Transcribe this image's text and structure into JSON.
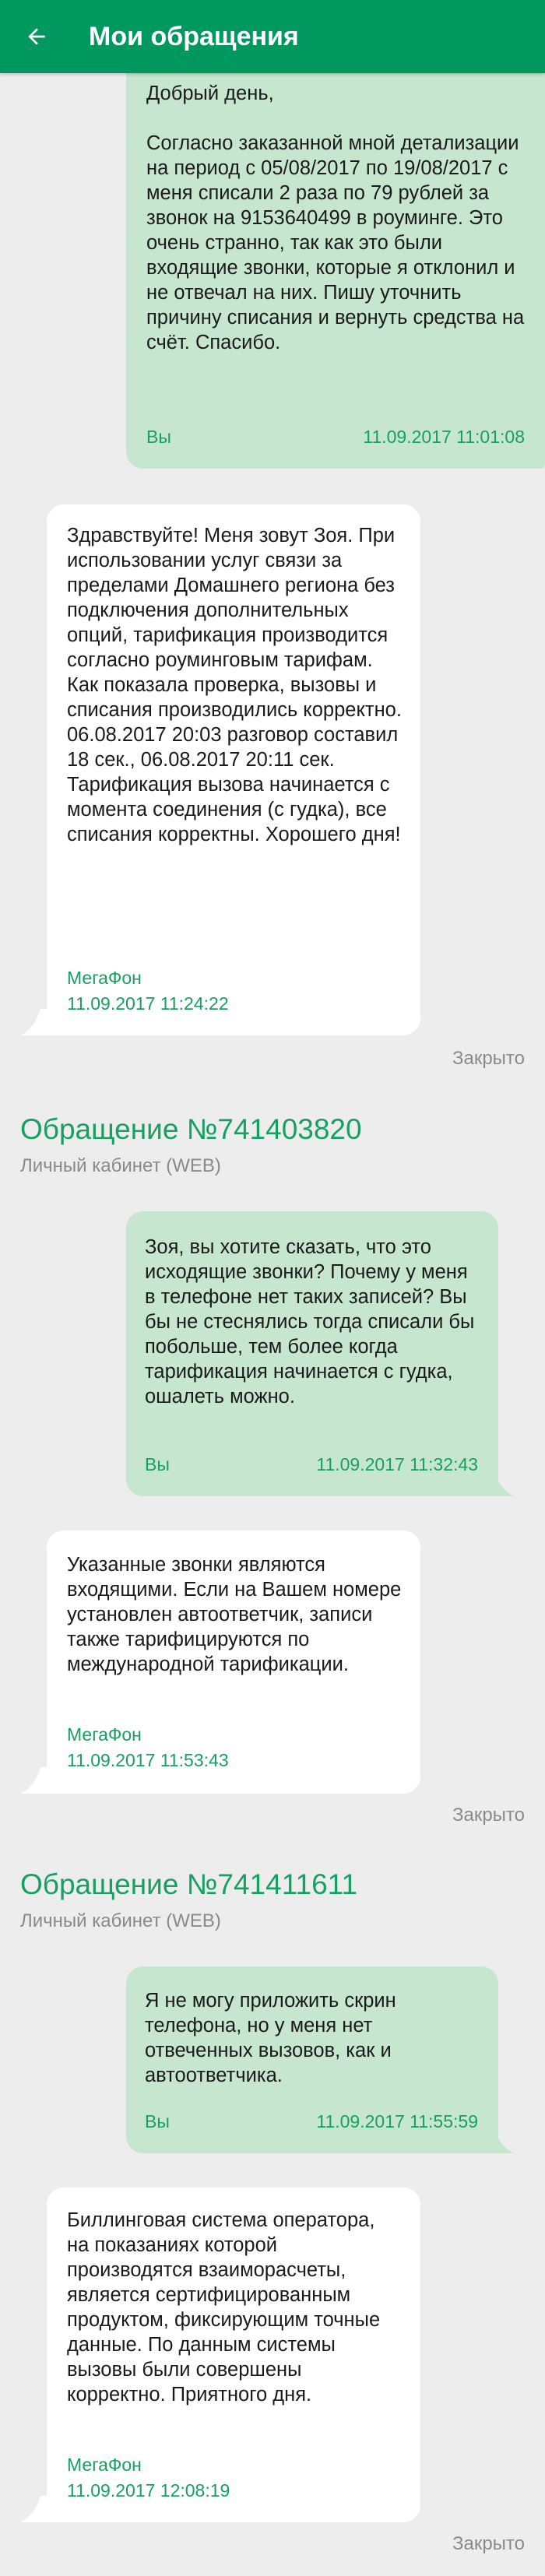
{
  "header": {
    "title": "Мои обращения",
    "back_icon": "arrow-left-icon"
  },
  "colors": {
    "primary": "#00985f",
    "accent_text": "#17a062",
    "my_bubble": "#c7e6cf",
    "reply_bubble": "#ffffff",
    "background": "#ededed"
  },
  "thread1": {
    "user_message": {
      "text": "Добрый день,\n\nСогласно заказанной мной детализации на период с 05/08/2017 по 19/08/2017 с меня списали 2 раза по 79 рублей за звонок на 9153640499 в роуминге. Это очень странно, так как это были входящие звонки, которые я отклонил и не отвечал на них. Пишу уточнить причину списания и вернуть средства на счёт. Спасибо.",
      "author": "Вы",
      "time": "11.09.2017 11:01:08"
    },
    "reply": {
      "text": "Здравствуйте! Меня зовут Зоя. При использовании услуг связи за пределами Домашнего региона без подключения дополнительных опций, тарификация производится согласно роуминговым тарифам. Как показала проверка, вызовы и списания производились корректно. 06.08.2017 20:03 разговор составил 18 сек., 06.08.2017 20:11 сек. Тарификация вызова начинается с момента соединения (с гудка), все списания корректны. Хорошего дня!",
      "author": "МегаФон",
      "time": "11.09.2017 11:24:22"
    },
    "status": "Закрыто"
  },
  "thread2": {
    "title": "Обращение №741403820",
    "channel": "Личный кабинет (WEB)",
    "user_message": {
      "text": "Зоя, вы хотите сказать, что это исходящие звонки? Почему у меня в телефоне нет таких записей? Вы бы не стеснялись тогда списали бы побольше, тем более когда тарификация начинается с гудка, ошалеть можно.",
      "author": "Вы",
      "time": "11.09.2017 11:32:43"
    },
    "reply": {
      "text": "Указанные звонки являются входящими. Если на Вашем номере установлен автоответчик, записи также тарифицируются по международной тарификации.",
      "author": "МегаФон",
      "time": "11.09.2017 11:53:43"
    },
    "status": "Закрыто"
  },
  "thread3": {
    "title": "Обращение №741411611",
    "channel": "Личный кабинет (WEB)",
    "user_message": {
      "text": "Я не могу приложить скрин телефона, но у меня нет отвеченных вызовов, как и автоответчика.",
      "author": "Вы",
      "time": "11.09.2017 11:55:59"
    },
    "reply": {
      "text": "Биллинговая система оператора, на показаниях которой производятся взаиморасчеты, является сертифицированным продуктом, фиксирующим точные данные. По данным системы вызовы были совершены корректно. Приятного дня.",
      "author": "МегаФон",
      "time": "11.09.2017 12:08:19"
    },
    "status": "Закрыто"
  }
}
